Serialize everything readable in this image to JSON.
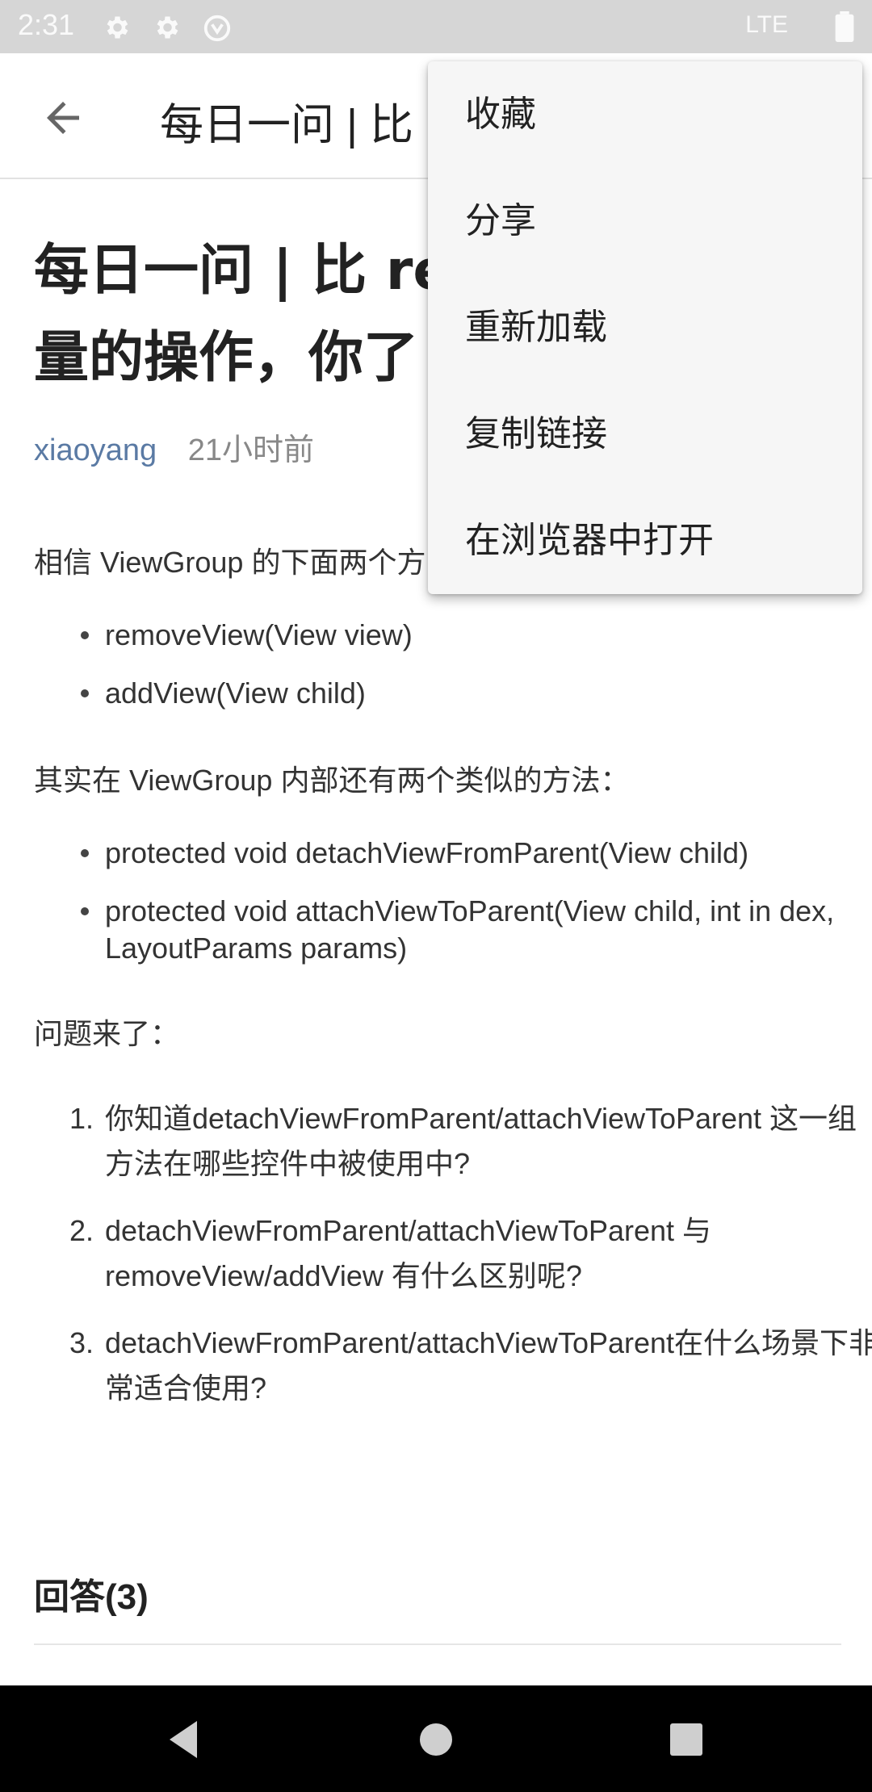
{
  "status_bar": {
    "time": "2:31",
    "network": "LTE",
    "icons": [
      "settings-icon",
      "settings-icon",
      "sync-icon",
      "battery-icon"
    ]
  },
  "app_bar": {
    "title": "每日一问 | 比"
  },
  "article": {
    "headline": "每日一问 | 比 re\n量的操作，你了",
    "author": "xiaoyang",
    "time_ago": "21小时前",
    "intro": "相信 ViewGroup 的下面两个方",
    "bullets_1": [
      "removeView(View view)",
      "addView(View child)"
    ],
    "para_2": "其实在 ViewGroup 内部还有两个类似的方法：",
    "bullets_2": [
      "protected void detachViewFromParent(View child)",
      "protected void attachViewToParent(View child, int in dex, LayoutParams params)"
    ],
    "para_3": "问题来了：",
    "questions": [
      {
        "num": "1.",
        "text": "你知道detachViewFromParent/attachViewToParent 这一组方法在哪些控件中被使用中?"
      },
      {
        "num": "2.",
        "text": "detachViewFromParent/attachViewToParent 与 removeView/addView 有什么区别呢?"
      },
      {
        "num": "3.",
        "text": "detachViewFromParent/attachViewToParent在什么场景下非常适合使用?"
      }
    ],
    "answers_heading": "回答(3)"
  },
  "overflow_menu": {
    "items": [
      "收藏",
      "分享",
      "重新加载",
      "复制链接",
      "在浏览器中打开"
    ]
  },
  "nav_bar": {
    "icons": [
      "back-triangle-icon",
      "home-circle-icon",
      "recents-square-icon"
    ]
  },
  "colors": {
    "author_link": "#5a7aa4",
    "status_bar_bg": "#d6d6d6",
    "menu_bg": "#f6f6f6"
  }
}
